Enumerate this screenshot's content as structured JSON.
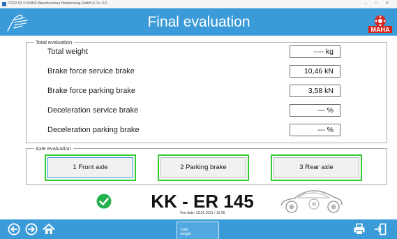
{
  "window": {
    "title": "CSD2-53  © MAHA Maschinenbau Haldenwang GmbH & Co. KG",
    "minimize_glyph": "–",
    "maximize_glyph": "□",
    "close_glyph": "✕"
  },
  "header": {
    "title": "Final evaluation",
    "logo_text": "MAHA",
    "background": "#3b9ad8"
  },
  "total_evaluation": {
    "legend": "Total evaluation",
    "rows": [
      {
        "label": "Total weight",
        "value": "---- kg"
      },
      {
        "label": "Brake force service brake",
        "value": "10,46 kN"
      },
      {
        "label": "Brake force parking brake",
        "value": "3,58 kN"
      },
      {
        "label": "Deceleration service brake",
        "value": "--- %"
      },
      {
        "label": "Deceleration parking brake",
        "value": "--- %"
      }
    ]
  },
  "axle_evaluation": {
    "legend": "Axle evaluation",
    "buttons": [
      {
        "label": "1 Front axle",
        "focused": true
      },
      {
        "label": "2 Parking brake",
        "focused": false
      },
      {
        "label": "3 Rear axle",
        "focused": false
      }
    ],
    "highlight_color": "#33cc33"
  },
  "result": {
    "status_icon": "check-circle-icon",
    "status_color": "#22b14c",
    "plate": "KK - ER 145",
    "test_date": "Test date: 18.01.2021 / 15:05"
  },
  "footer": {
    "icons": [
      "back-arrow-icon",
      "forward-arrow-icon",
      "home-icon",
      "print-icon",
      "exit-icon"
    ],
    "tab_line1": "Total",
    "tab_line2": "weight"
  }
}
